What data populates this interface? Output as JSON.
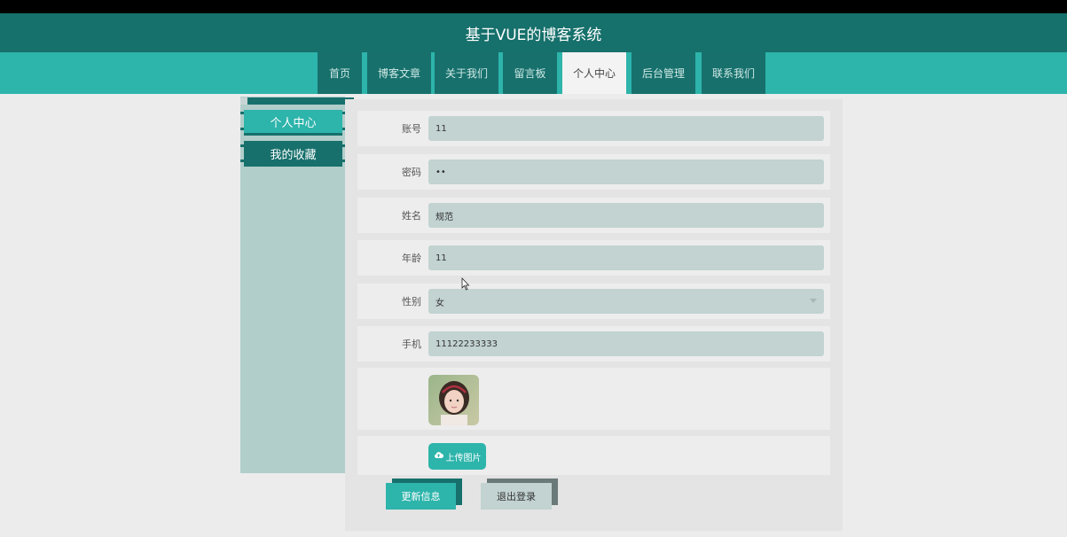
{
  "header": {
    "title": "基于VUE的博客系统"
  },
  "nav": {
    "items": [
      {
        "label": "首页",
        "active": false
      },
      {
        "label": "博客文章",
        "active": false
      },
      {
        "label": "关于我们",
        "active": false
      },
      {
        "label": "留言板",
        "active": false
      },
      {
        "label": "个人中心",
        "active": true
      },
      {
        "label": "后台管理",
        "active": false
      },
      {
        "label": "联系我们",
        "active": false
      }
    ]
  },
  "sidebar": {
    "items": [
      {
        "label": "个人中心",
        "active": true
      },
      {
        "label": "我的收藏",
        "active": false
      }
    ]
  },
  "form": {
    "fields": [
      {
        "label": "账号",
        "value": "11"
      },
      {
        "label": "密码",
        "value": "••"
      },
      {
        "label": "姓名",
        "value": "规范"
      },
      {
        "label": "年龄",
        "value": "11"
      },
      {
        "label": "性别",
        "value": "女"
      },
      {
        "label": "手机",
        "value": "11122233333"
      }
    ],
    "upload_label": "上传图片",
    "update_label": "更新信息",
    "logout_label": "退出登录"
  },
  "colors": {
    "header": "#16706b",
    "accent": "#2db4ab",
    "input_bg": "#c2d3d1",
    "sidebar_bg": "#b1cecb"
  },
  "icons": {
    "upload": "cloud-upload-icon",
    "select": "chevron-down-icon"
  }
}
